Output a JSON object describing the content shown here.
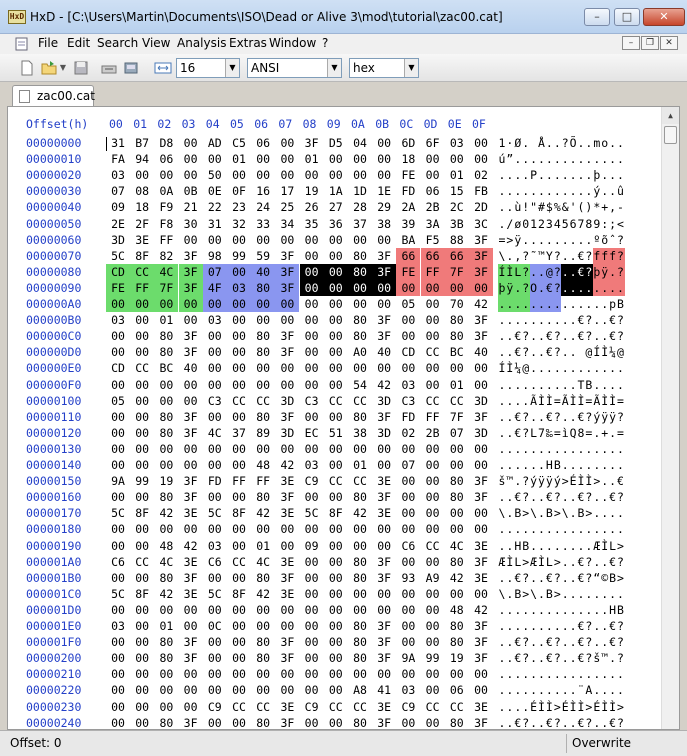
{
  "window": {
    "app_badge": "HxD",
    "title": "HxD - [C:\\Users\\Martin\\Documents\\ISO\\Dead or Alive 3\\mod\\tutorial\\zac00.cat]",
    "min": "–",
    "max": "□",
    "close": "✕"
  },
  "menu": [
    "File",
    "Edit",
    "Search",
    "View",
    "Analysis",
    "Extras",
    "Window",
    "?"
  ],
  "toolbar": {
    "bytes_per_row": "16",
    "charset": "ANSI",
    "offset_base": "hex"
  },
  "tab": {
    "label": "zac00.cat"
  },
  "header": {
    "offset_label": "Offset(h)",
    "columns": [
      "00",
      "01",
      "02",
      "03",
      "04",
      "05",
      "06",
      "07",
      "08",
      "09",
      "0A",
      "0B",
      "0C",
      "0D",
      "0E",
      "0F"
    ]
  },
  "colors": {
    "green": "#6cdc6c",
    "blue": "#8a96f0",
    "black": "#000000",
    "red": "#f07a7a",
    "offset_blue": "#2440c8"
  },
  "rows": [
    {
      "offset": "00000000",
      "hex": "31 B7 D8 00 AD C5 06 00 3F D5 04 00 6D 6F 03 00",
      "text": "1·Ø.­Å..?Õ..mo.."
    },
    {
      "offset": "00000010",
      "hex": "FA 94 06 00 00 01 00 00 01 00 00 00 18 00 00 00",
      "text": "ú”.............."
    },
    {
      "offset": "00000020",
      "hex": "03 00 00 00 50 00 00 00 00 00 00 00 FE 00 01 02",
      "text": "....P.......þ..."
    },
    {
      "offset": "00000030",
      "hex": "07 08 0A 0B 0E 0F 16 17 19 1A 1D 1E FD 06 15 FB",
      "text": "............ý..û"
    },
    {
      "offset": "00000040",
      "hex": "09 18 F9 21 22 23 24 25 26 27 28 29 2A 2B 2C 2D",
      "text": "..ù!\"#$%&'()*+,-"
    },
    {
      "offset": "00000050",
      "hex": "2E 2F F8 30 31 32 33 34 35 36 37 38 39 3A 3B 3C",
      "text": "./ø0123456789:;<"
    },
    {
      "offset": "00000060",
      "hex": "3D 3E FF 00 00 00 00 00 00 00 00 00 BA F5 88 3F",
      "text": "=>ÿ.........ºõˆ?"
    },
    {
      "offset": "00000070",
      "hex": "5C 8F 82 3F 98 99 59 3F 00 00 80 3F 66 66 66 3F",
      "text": "\\.‚?˜™Y?..€?fff?"
    },
    {
      "offset": "00000080",
      "hex": "CD CC 4C 3F 07 00 40 3F 00 00 80 3F FE FF 7F 3F",
      "text": "ÍÌL?..@?..€?þÿ.?"
    },
    {
      "offset": "00000090",
      "hex": "FE FF 7F 3F 4F 03 80 3F 00 00 00 00 00 00 00 00",
      "text": "þÿ.?O.€?........"
    },
    {
      "offset": "000000A0",
      "hex": "00 00 00 00 00 00 00 00 00 00 00 00 05 00 70 42",
      "text": "..............pB"
    },
    {
      "offset": "000000B0",
      "hex": "03 00 01 00 03 00 00 00 00 00 80 3F 00 00 80 3F",
      "text": "..........€?..€?"
    },
    {
      "offset": "000000C0",
      "hex": "00 00 80 3F 00 00 80 3F 00 00 80 3F 00 00 80 3F",
      "text": "..€?..€?..€?..€?"
    },
    {
      "offset": "000000D0",
      "hex": "00 00 80 3F 00 00 80 3F 00 00 A0 40 CD CC BC 40",
      "text": "..€?..€?.. @ÍÌ¼@"
    },
    {
      "offset": "000000E0",
      "hex": "CD CC BC 40 00 00 00 00 00 00 00 00 00 00 00 00",
      "text": "ÍÌ¼@............"
    },
    {
      "offset": "000000F0",
      "hex": "00 00 00 00 00 00 00 00 00 00 54 42 03 00 01 00",
      "text": "..........TB...."
    },
    {
      "offset": "00000100",
      "hex": "05 00 00 00 C3 CC CC 3D C3 CC CC 3D C3 CC CC 3D",
      "text": "....ÃÌÌ=ÃÌÌ=ÃÌÌ="
    },
    {
      "offset": "00000110",
      "hex": "00 00 80 3F 00 00 80 3F 00 00 80 3F FD FF 7F 3F",
      "text": "..€?..€?..€?ýÿÿ?"
    },
    {
      "offset": "00000120",
      "hex": "00 00 80 3F 4C 37 89 3D EC 51 38 3D 02 2B 07 3D",
      "text": "..€?L7‰=ìQ8=.+.="
    },
    {
      "offset": "00000130",
      "hex": "00 00 00 00 00 00 00 00 00 00 00 00 00 00 00 00",
      "text": "................"
    },
    {
      "offset": "00000140",
      "hex": "00 00 00 00 00 00 48 42 03 00 01 00 07 00 00 00",
      "text": "......HB........"
    },
    {
      "offset": "00000150",
      "hex": "9A 99 19 3F FD FF FF 3E C9 CC CC 3E 00 00 80 3F",
      "text": "š™.?ýÿÿý>ÉÌÌ>..€?"
    },
    {
      "offset": "00000160",
      "hex": "00 00 80 3F 00 00 80 3F 00 00 80 3F 00 00 80 3F",
      "text": "..€?..€?..€?..€?"
    },
    {
      "offset": "00000170",
      "hex": "5C 8F 42 3E 5C 8F 42 3E 5C 8F 42 3E 00 00 00 00",
      "text": "\\.B>\\.B>\\.B>...."
    },
    {
      "offset": "00000180",
      "hex": "00 00 00 00 00 00 00 00 00 00 00 00 00 00 00 00",
      "text": "................"
    },
    {
      "offset": "00000190",
      "hex": "00 00 48 42 03 00 01 00 09 00 00 00 C6 CC 4C 3E",
      "text": "..HB........ÆÌL>"
    },
    {
      "offset": "000001A0",
      "hex": "C6 CC 4C 3E C6 CC 4C 3E 00 00 80 3F 00 00 80 3F",
      "text": "ÆÌL>ÆÌL>..€?..€?"
    },
    {
      "offset": "000001B0",
      "hex": "00 00 80 3F 00 00 80 3F 00 00 80 3F 93 A9 42 3E",
      "text": "..€?..€?..€?“©B>"
    },
    {
      "offset": "000001C0",
      "hex": "5C 8F 42 3E 5C 8F 42 3E 00 00 00 00 00 00 00 00",
      "text": "\\.B>\\.B>........"
    },
    {
      "offset": "000001D0",
      "hex": "00 00 00 00 00 00 00 00 00 00 00 00 00 00 48 42",
      "text": "..............HB"
    },
    {
      "offset": "000001E0",
      "hex": "03 00 01 00 0C 00 00 00 00 00 80 3F 00 00 80 3F",
      "text": "..........€?..€?"
    },
    {
      "offset": "000001F0",
      "hex": "00 00 80 3F 00 00 80 3F 00 00 80 3F 00 00 80 3F",
      "text": "..€?..€?..€?..€?"
    },
    {
      "offset": "00000200",
      "hex": "00 00 80 3F 00 00 80 3F 00 00 80 3F 9A 99 19 3F",
      "text": "..€?..€?..€?š™.?"
    },
    {
      "offset": "00000210",
      "hex": "00 00 00 00 00 00 00 00 00 00 00 00 00 00 00 00",
      "text": "................"
    },
    {
      "offset": "00000220",
      "hex": "00 00 00 00 00 00 00 00 00 00 A8 41 03 00 06 00",
      "text": "..........¨A...."
    },
    {
      "offset": "00000230",
      "hex": "00 00 00 00 C9 CC CC 3E C9 CC CC 3E C9 CC CC 3E",
      "text": "....ÉÌÌ>ÉÌÌ>ÉÌÌ>"
    },
    {
      "offset": "00000240",
      "hex": "00 00 80 3F 00 00 80 3F 00 00 80 3F 00 00 80 3F",
      "text": "..€?..€?..€?..€?"
    }
  ],
  "highlights": [
    {
      "from": 124,
      "to": 127,
      "color": "red"
    },
    {
      "from": 128,
      "to": 131,
      "color": "green"
    },
    {
      "from": 132,
      "to": 135,
      "color": "blue"
    },
    {
      "from": 136,
      "to": 139,
      "color": "black"
    },
    {
      "from": 140,
      "to": 143,
      "color": "red"
    },
    {
      "from": 144,
      "to": 147,
      "color": "green"
    },
    {
      "from": 148,
      "to": 151,
      "color": "blue"
    },
    {
      "from": 152,
      "to": 155,
      "color": "black"
    },
    {
      "from": 156,
      "to": 159,
      "color": "red"
    },
    {
      "from": 160,
      "to": 163,
      "color": "green"
    },
    {
      "from": 164,
      "to": 167,
      "color": "blue"
    }
  ],
  "status": {
    "offset": "Offset: 0",
    "mode": "Overwrite"
  }
}
